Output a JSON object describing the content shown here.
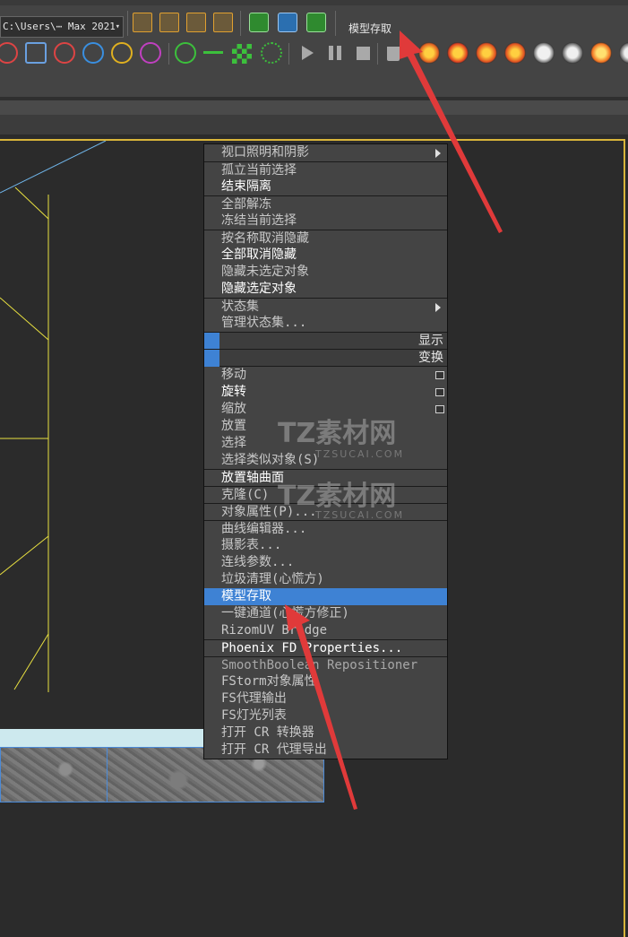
{
  "toolbar": {
    "path_value": "C:\\Users\\⋯ Max 2021",
    "dropdown_glyph": "▾",
    "script_label": "模型存取",
    "icons_row1": [
      "layer-gear-icon",
      "layer-add-icon",
      "layer-remove-icon",
      "layer-select-icon",
      "green-refresh-icon",
      "blue-sync-icon",
      "green-export-icon"
    ],
    "icons_row2": [
      "box-icon",
      "cube-icon",
      "fire-circle-icon",
      "drop-circle-icon",
      "rings-icon",
      "target-icon",
      "network-icon",
      "arrow-split-icon",
      "checker-icon",
      "burst-icon",
      "play-icon",
      "pause-icon",
      "stop-icon",
      "trash-icon",
      "fire-icon",
      "fire-icon",
      "fire-icon",
      "fire-icon",
      "settings-fire-icon",
      "swirl-icon",
      "flame-icon"
    ]
  },
  "menu": {
    "items": [
      {
        "label": "视口照明和阴影",
        "style": "normal",
        "submenu": true,
        "sep": false
      },
      {
        "label": "孤立当前选择",
        "style": "normal",
        "sep": true
      },
      {
        "label": "结束隔离",
        "style": "bright",
        "sep": false
      },
      {
        "label": "全部解冻",
        "style": "normal",
        "sep": true
      },
      {
        "label": "冻结当前选择",
        "style": "normal",
        "sep": false
      },
      {
        "label": "按名称取消隐藏",
        "style": "normal",
        "sep": true
      },
      {
        "label": "全部取消隐藏",
        "style": "bright",
        "sep": false
      },
      {
        "label": "隐藏未选定对象",
        "style": "normal",
        "sep": false
      },
      {
        "label": "隐藏选定对象",
        "style": "bright",
        "sep": false
      },
      {
        "label": "状态集",
        "style": "normal",
        "submenu": true,
        "sep": true
      },
      {
        "label": "管理状态集...",
        "style": "normal",
        "sep": false
      }
    ],
    "header_display": "显示",
    "header_transform": "变换",
    "transform_items": [
      {
        "label": "移动",
        "style": "normal",
        "check": true,
        "sep": false
      },
      {
        "label": "旋转",
        "style": "bright",
        "check": true,
        "sep": false
      },
      {
        "label": "缩放",
        "style": "normal",
        "check": true,
        "sep": false
      },
      {
        "label": "放置",
        "style": "normal",
        "sep": false
      },
      {
        "label": "选择",
        "style": "normal",
        "sep": false
      },
      {
        "label": "选择类似对象(S)",
        "style": "normal",
        "sep": false
      },
      {
        "label": "放置轴曲面",
        "style": "bright",
        "sep": true
      },
      {
        "label": "克隆(C)",
        "style": "normal",
        "sep": true
      },
      {
        "label": "对象属性(P)...",
        "style": "normal",
        "sep": true
      },
      {
        "label": "曲线编辑器...",
        "style": "normal",
        "sep": true
      },
      {
        "label": "摄影表...",
        "style": "normal",
        "sep": false
      },
      {
        "label": "连线参数...",
        "style": "normal",
        "sep": false
      },
      {
        "label": "垃圾清理(心慌方)",
        "style": "normal",
        "sep": false
      },
      {
        "label": "模型存取",
        "style": "highlight",
        "sep": false
      },
      {
        "label": "一键通道(心慌方修正)",
        "style": "normal",
        "sep": false
      },
      {
        "label": "RizomUV Bridge",
        "style": "normal",
        "sep": false
      },
      {
        "label": "Phoenix FD Properties...",
        "style": "bright",
        "sep": true
      },
      {
        "label": "SmoothBoolean Repositioner",
        "style": "dim",
        "sep": true
      },
      {
        "label": "FStorm对象属性",
        "style": "normal",
        "sep": false
      },
      {
        "label": "FS代理输出",
        "style": "normal",
        "sep": false
      },
      {
        "label": "FS灯光列表",
        "style": "normal",
        "sep": false
      },
      {
        "label": "打开 CR 转换器",
        "style": "normal",
        "sep": false
      },
      {
        "label": "打开 CR 代理导出",
        "style": "normal",
        "sep": false
      }
    ]
  },
  "watermark": {
    "brand": "TZ素材网",
    "site": "TZSUCAI.COM"
  },
  "colors": {
    "highlight": "#3e82d4",
    "viewport_border": "#d8b53a",
    "annotation_arrow": "#e03a3a"
  }
}
